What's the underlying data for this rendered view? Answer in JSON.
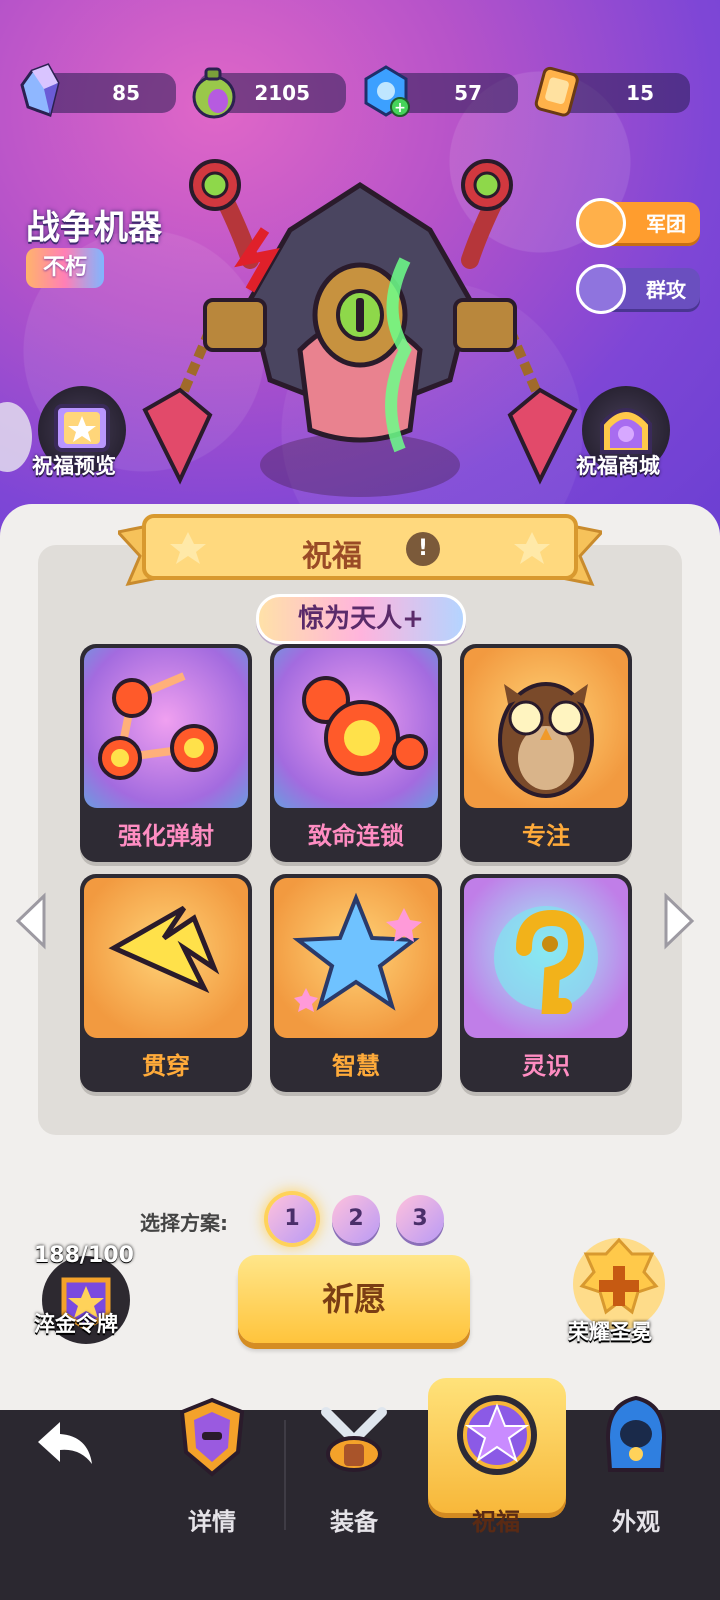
{
  "currencies": [
    {
      "icon": "crystal-icon",
      "value": "85"
    },
    {
      "icon": "potion-icon",
      "value": "2105"
    },
    {
      "icon": "hex-gem-plus-icon",
      "value": "57"
    },
    {
      "icon": "scroll-ticket-icon",
      "value": "15"
    }
  ],
  "boss": {
    "name": "战争机器",
    "rank": "不朽"
  },
  "side_buttons": {
    "legion": "军团",
    "group_attack": "群攻"
  },
  "shortcuts": {
    "blessing_preview": "祝福预览",
    "blessing_shop": "祝福商城"
  },
  "panel": {
    "title": "祝福",
    "info_mark": "!",
    "tier": "惊为天人+",
    "cards": [
      {
        "label": "强化弹射",
        "icon": "bounce-link-icon",
        "style": "purple"
      },
      {
        "label": "致命连锁",
        "icon": "explosion-chain-icon",
        "style": "purple"
      },
      {
        "label": "专注",
        "icon": "owl-icon",
        "style": "orange"
      },
      {
        "label": "贯穿",
        "icon": "piercing-arrow-icon",
        "style": "orange"
      },
      {
        "label": "智慧",
        "icon": "crystal-star-icon",
        "style": "orange"
      },
      {
        "label": "灵识",
        "icon": "golden-spiral-icon",
        "style": "violet"
      }
    ]
  },
  "plan": {
    "label": "选择方案:",
    "options": [
      "1",
      "2",
      "3"
    ],
    "selected": "1"
  },
  "pray_button": "祈愿",
  "token": {
    "count": "188/100",
    "name": "淬金令牌"
  },
  "crown": {
    "name": "荣耀圣冕"
  },
  "nav": {
    "back": "back-arrow-icon",
    "items": [
      {
        "label": "详情",
        "icon": "helmet-shield-icon"
      },
      {
        "label": "装备",
        "icon": "crossed-swords-icon"
      },
      {
        "label": "祝福",
        "icon": "purple-star-icon"
      },
      {
        "label": "外观",
        "icon": "hooded-cloak-icon"
      }
    ],
    "active": "祝福"
  }
}
